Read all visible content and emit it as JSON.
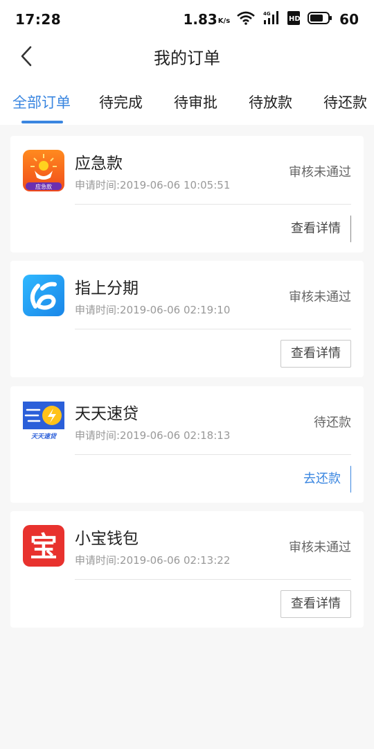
{
  "status_bar": {
    "time": "17:28",
    "speed": "1.83",
    "speed_unit": "K/s",
    "network": "4G",
    "hd": "HD",
    "battery": "60"
  },
  "header": {
    "title": "我的订单"
  },
  "tabs": [
    {
      "label": "全部订单",
      "active": true
    },
    {
      "label": "待完成",
      "active": false
    },
    {
      "label": "待审批",
      "active": false
    },
    {
      "label": "待放款",
      "active": false
    },
    {
      "label": "待还款",
      "active": false
    }
  ],
  "orders": [
    {
      "name": "应急款",
      "time": "申请时间:2019-06-06 10:05:51",
      "status": "审核未通过",
      "action": "查看详情",
      "logo_text": "应急款"
    },
    {
      "name": "指上分期",
      "time": "申请时间:2019-06-06 02:19:10",
      "status": "审核未通过",
      "action": "查看详情"
    },
    {
      "name": "天天速贷",
      "time": "申请时间:2019-06-06 02:18:13",
      "status": "待还款",
      "action": "去还款",
      "logo_text": "天天速贷"
    },
    {
      "name": "小宝钱包",
      "time": "申请时间:2019-06-06 02:13:22",
      "status": "审核未通过",
      "action": "查看详情",
      "logo_text": "宝"
    }
  ],
  "colors": {
    "accent": "#3a86e0",
    "background": "#f7f7f7"
  }
}
